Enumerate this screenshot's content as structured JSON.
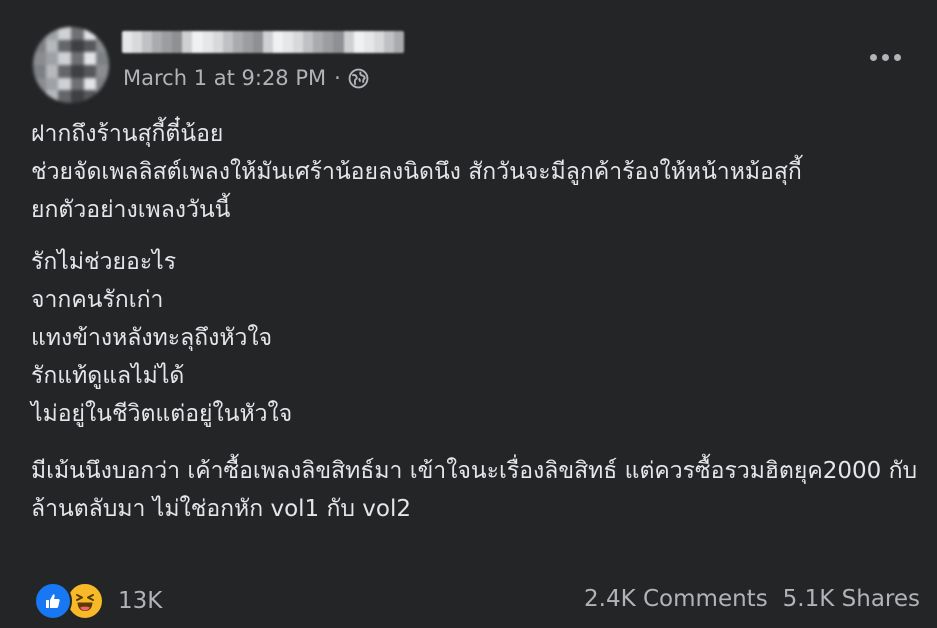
{
  "post": {
    "author_name": "",
    "timestamp": "March 1 at 9:28 PM",
    "separator": "·",
    "audience_icon": "globe-icon",
    "more_icon": "more-options-icon",
    "body": {
      "p1": [
        "ฝากถึงร้านสุกี้ตี๋น้อย",
        "ช่วยจัดเพลลิสต์เพลงให้มันเศร้าน้อยลงนิดนึง สักวันจะมีลูกค้าร้องให้หน้าหม้อสุกี้",
        "ยกตัวอย่างเพลงวันนี้"
      ],
      "p2": [
        "รักไม่ช่วยอะไร",
        "จากคนรักเก่า",
        "แทงข้างหลังทะลุถึงหัวใจ",
        "รักแท้ดูแลไม่ได้",
        "ไม่อยู่ในชีวิตแต่อยู่ในหัวใจ"
      ],
      "p3": [
        "มีเม้นนึงบอกว่า เค้าซื้อเพลงลิขสิทธ์มา เข้าใจนะเรื่องลิขสิทธ์ แต่ควรซื้อรวมฮิตยุค2000 กับล้านตลับมา ไม่ใช่อกหัก vol1 กับ vol2"
      ]
    },
    "reactions": {
      "icons": [
        "like-icon",
        "haha-icon"
      ],
      "count": "13K"
    },
    "comments": "2.4K Comments",
    "shares": "5.1K Shares"
  },
  "colors": {
    "background": "#242526",
    "primary_text": "#e4e6eb",
    "secondary_text": "#b0b3b8",
    "like_blue": "#1877f2",
    "haha_yellow": "#f7b928"
  }
}
